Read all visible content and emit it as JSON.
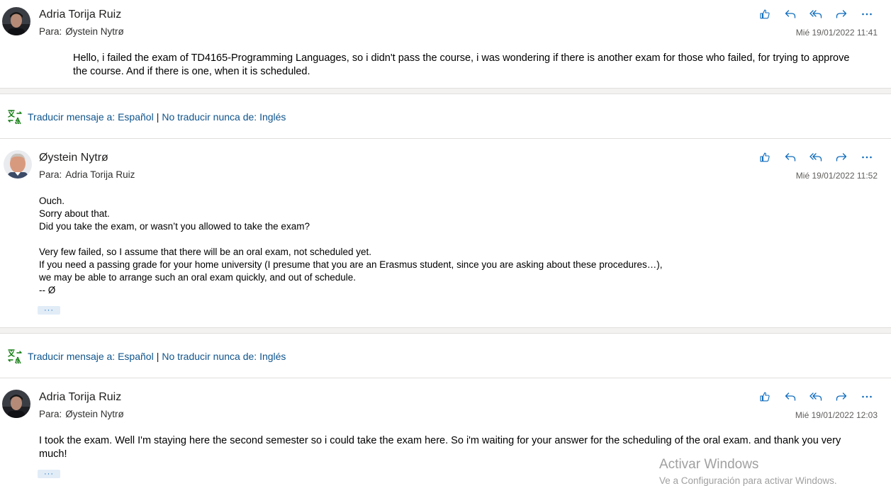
{
  "actions": {
    "like_icon": "thumbs-up-icon",
    "reply_icon": "reply-icon",
    "reply_all_icon": "reply-all-icon",
    "forward_icon": "forward-icon",
    "more_icon": "more-icon"
  },
  "messages": [
    {
      "sender": "Adria Torija Ruiz",
      "to_label": "Para:",
      "to": "Øystein Nytrø",
      "date": "Mié 19/01/2022 11:41",
      "body": [
        "Hello, i failed the exam of TD4165-Programming Languages, so i didn't pass the course, i was wondering if there is another exam for those who failed, for trying to approve",
        "the course. And if there is one, when it is scheduled."
      ]
    },
    {
      "sender": "Øystein Nytrø",
      "to_label": "Para:",
      "to": "Adria Torija Ruiz",
      "date": "Mié 19/01/2022 11:52",
      "body": [
        "Ouch.",
        "Sorry about that.",
        "Did you take the exam, or wasn’t you allowed to take the exam?",
        "",
        "Very few failed, so I assume that there will be an oral exam, not scheduled yet.",
        "If you need a passing grade for your home university (I presume that you are an Erasmus student, since you are asking about these procedures…),",
        "we may be able to arrange such an oral exam quickly, and out of schedule.",
        "-- Ø"
      ],
      "more_label": "···"
    },
    {
      "sender": "Adria Torija Ruiz",
      "to_label": "Para:",
      "to": "Øystein Nytrø",
      "date": "Mié 19/01/2022 12:03",
      "body": [
        "I took the exam. Well I'm staying here the second semester so i could take the exam here. So i'm waiting for your answer for the scheduling of the oral exam. and thank you very",
        "much!"
      ],
      "more_label": "···"
    }
  ],
  "translate": {
    "icon": "translate-icon",
    "translate_link": "Traducir mensaje a: Español",
    "separator": "|",
    "never_link": "No traducir nunca de: Inglés"
  },
  "watermark": {
    "title": "Activar Windows",
    "subtitle": "Ve a Configuración para activar Windows."
  },
  "colors": {
    "link": "#0f548c",
    "icon_blue": "#0f6cbd",
    "translate_icon": "#107c10"
  }
}
